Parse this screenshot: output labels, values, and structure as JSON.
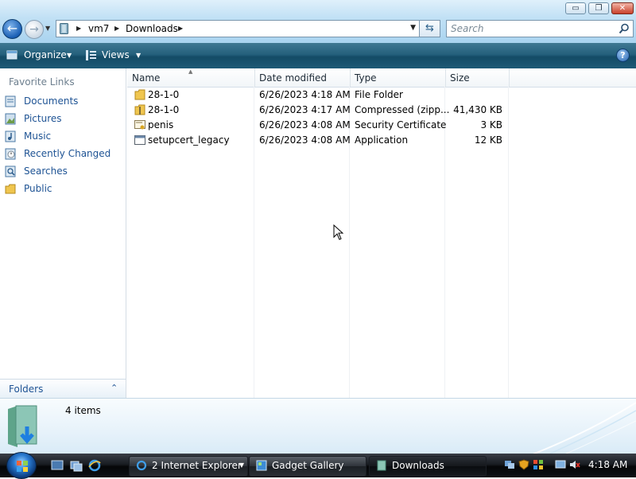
{
  "window": {
    "controls": {
      "minimize": "▭",
      "maximize": "❐",
      "close": "✕"
    }
  },
  "address": {
    "crumbs": [
      "vm7",
      "Downloads"
    ],
    "search_placeholder": "Search"
  },
  "toolbar": {
    "organize": "Organize",
    "views": "Views",
    "help": "?"
  },
  "sidebar": {
    "title": "Favorite Links",
    "items": [
      {
        "label": "Documents",
        "icon": "documents-icon"
      },
      {
        "label": "Pictures",
        "icon": "pictures-icon"
      },
      {
        "label": "Music",
        "icon": "music-icon"
      },
      {
        "label": "Recently Changed",
        "icon": "recently-changed-icon"
      },
      {
        "label": "Searches",
        "icon": "searches-icon"
      },
      {
        "label": "Public",
        "icon": "folder-icon"
      }
    ],
    "folders_label": "Folders"
  },
  "filelist": {
    "columns": [
      "Name",
      "Date modified",
      "Type",
      "Size"
    ],
    "rows": [
      {
        "name": "28-1-0",
        "date": "6/26/2023 4:18 AM",
        "type": "File Folder",
        "size": "",
        "icon": "folder-icon"
      },
      {
        "name": "28-1-0",
        "date": "6/26/2023 4:17 AM",
        "type": "Compressed (zipp...",
        "size": "41,430 KB",
        "icon": "zip-folder-icon"
      },
      {
        "name": "penis",
        "date": "6/26/2023 4:08 AM",
        "type": "Security Certificate",
        "size": "3 KB",
        "icon": "certificate-icon"
      },
      {
        "name": "setupcert_legacy",
        "date": "6/26/2023 4:08 AM",
        "type": "Application",
        "size": "12 KB",
        "icon": "application-icon"
      }
    ]
  },
  "details": {
    "count": "4 items"
  },
  "taskbar": {
    "tasks": [
      {
        "label": "2 Internet Explorer"
      },
      {
        "label": "Gadget Gallery"
      },
      {
        "label": "Downloads"
      }
    ],
    "clock": "4:18 AM"
  },
  "colors": {
    "link": "#1e5394",
    "toolbar": "#1e5a76",
    "taskbar": "#0d1116"
  }
}
